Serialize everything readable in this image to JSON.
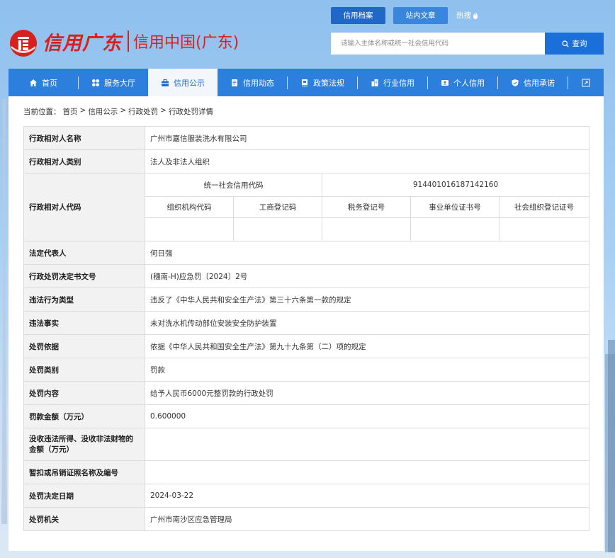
{
  "header": {
    "logo_script": "信用广东",
    "logo_cn": "信用中国(广东)",
    "top_tabs": [
      "信用档案",
      "站内文章",
      "热搜"
    ],
    "search_placeholder": "请输入主体名称或统一社会信用代码",
    "search_button": "查询"
  },
  "nav": {
    "items": [
      {
        "label": "首页",
        "icon": "home-icon"
      },
      {
        "label": "服务大厅",
        "icon": "grid-icon"
      },
      {
        "label": "信用公示",
        "icon": "briefcase-icon"
      },
      {
        "label": "信用动态",
        "icon": "document-icon"
      },
      {
        "label": "政策法规",
        "icon": "book-icon"
      },
      {
        "label": "行业信用",
        "icon": "building-icon"
      },
      {
        "label": "个人信用",
        "icon": "id-card-icon"
      },
      {
        "label": "信用承诺",
        "icon": "shield-check-icon"
      }
    ],
    "active_index": 2,
    "expand_icon": "expand-icon"
  },
  "breadcrumb": {
    "prefix": "当前位置：",
    "items": [
      "首页",
      "信用公示",
      "行政处罚",
      "行政处罚详情"
    ],
    "separator": ">"
  },
  "detail": {
    "rows": [
      {
        "label": "行政相对人名称",
        "value": "广州市嘉信服装洗水有限公司"
      },
      {
        "label": "行政相对人类别",
        "value": "法人及非法人组织"
      },
      {
        "label": "行政相对人代码",
        "code_header": "统一社会信用代码",
        "code_value": "914401016187142160",
        "sub_headers": [
          "组织机构代码",
          "工商登记码",
          "税务登记号",
          "事业单位证书号",
          "社会组织登记证号"
        ],
        "sub_values": [
          "",
          "",
          "",
          "",
          ""
        ]
      },
      {
        "label": "法定代表人",
        "value": "何日强"
      },
      {
        "label": "行政处罚决定书文号",
        "value": "(穗南-H)应急罚〔2024〕2号"
      },
      {
        "label": "违法行为类型",
        "value": "违反了《中华人民共和安全生产法》第三十六条第一款的规定"
      },
      {
        "label": "违法事实",
        "value": "未对洗水机传动部位安装安全防护装置"
      },
      {
        "label": "处罚依据",
        "value": "依据《中华人民共和国安全生产法》第九十九条第（二）项的规定"
      },
      {
        "label": "处罚类别",
        "value": "罚款"
      },
      {
        "label": "处罚内容",
        "value": "给予人民币6000元整罚款的行政处罚"
      },
      {
        "label": "罚款金额（万元）",
        "value": "0.600000"
      },
      {
        "label": "没收违法所得、没收非法财物的金额（万元）",
        "value": ""
      },
      {
        "label": "暂扣或吊销证照名称及编号",
        "value": ""
      },
      {
        "label": "处罚决定日期",
        "value": "2024-03-22"
      },
      {
        "label": "处罚机关",
        "value": "广州市南沙区应急管理局"
      }
    ]
  },
  "colors": {
    "brand_red": "#d8201c",
    "nav_blue": "#2d7fdd",
    "active_text": "#1f6fd6",
    "button_blue": "#1a6fd8"
  }
}
